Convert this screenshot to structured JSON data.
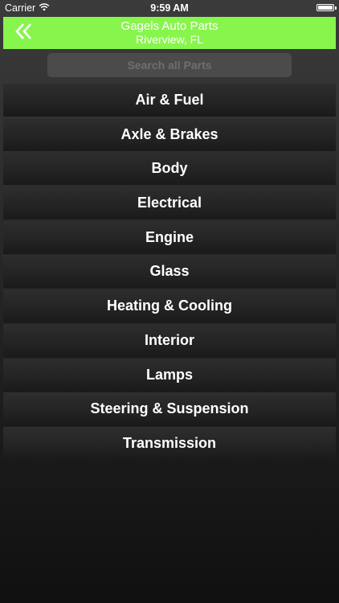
{
  "status_bar": {
    "carrier": "Carrier",
    "time": "9:59 AM"
  },
  "header": {
    "title": "Gagels Auto Parts",
    "subtitle": "Riverview, FL",
    "back_icon": "double-chevron-left-icon",
    "background_color": "#88f54d"
  },
  "search": {
    "placeholder": "Search all Parts",
    "value": ""
  },
  "categories": [
    {
      "label": "Air & Fuel"
    },
    {
      "label": "Axle & Brakes"
    },
    {
      "label": "Body"
    },
    {
      "label": "Electrical"
    },
    {
      "label": "Engine"
    },
    {
      "label": "Glass"
    },
    {
      "label": "Heating & Cooling"
    },
    {
      "label": "Interior"
    },
    {
      "label": "Lamps"
    },
    {
      "label": "Steering & Suspension"
    },
    {
      "label": "Transmission"
    }
  ]
}
